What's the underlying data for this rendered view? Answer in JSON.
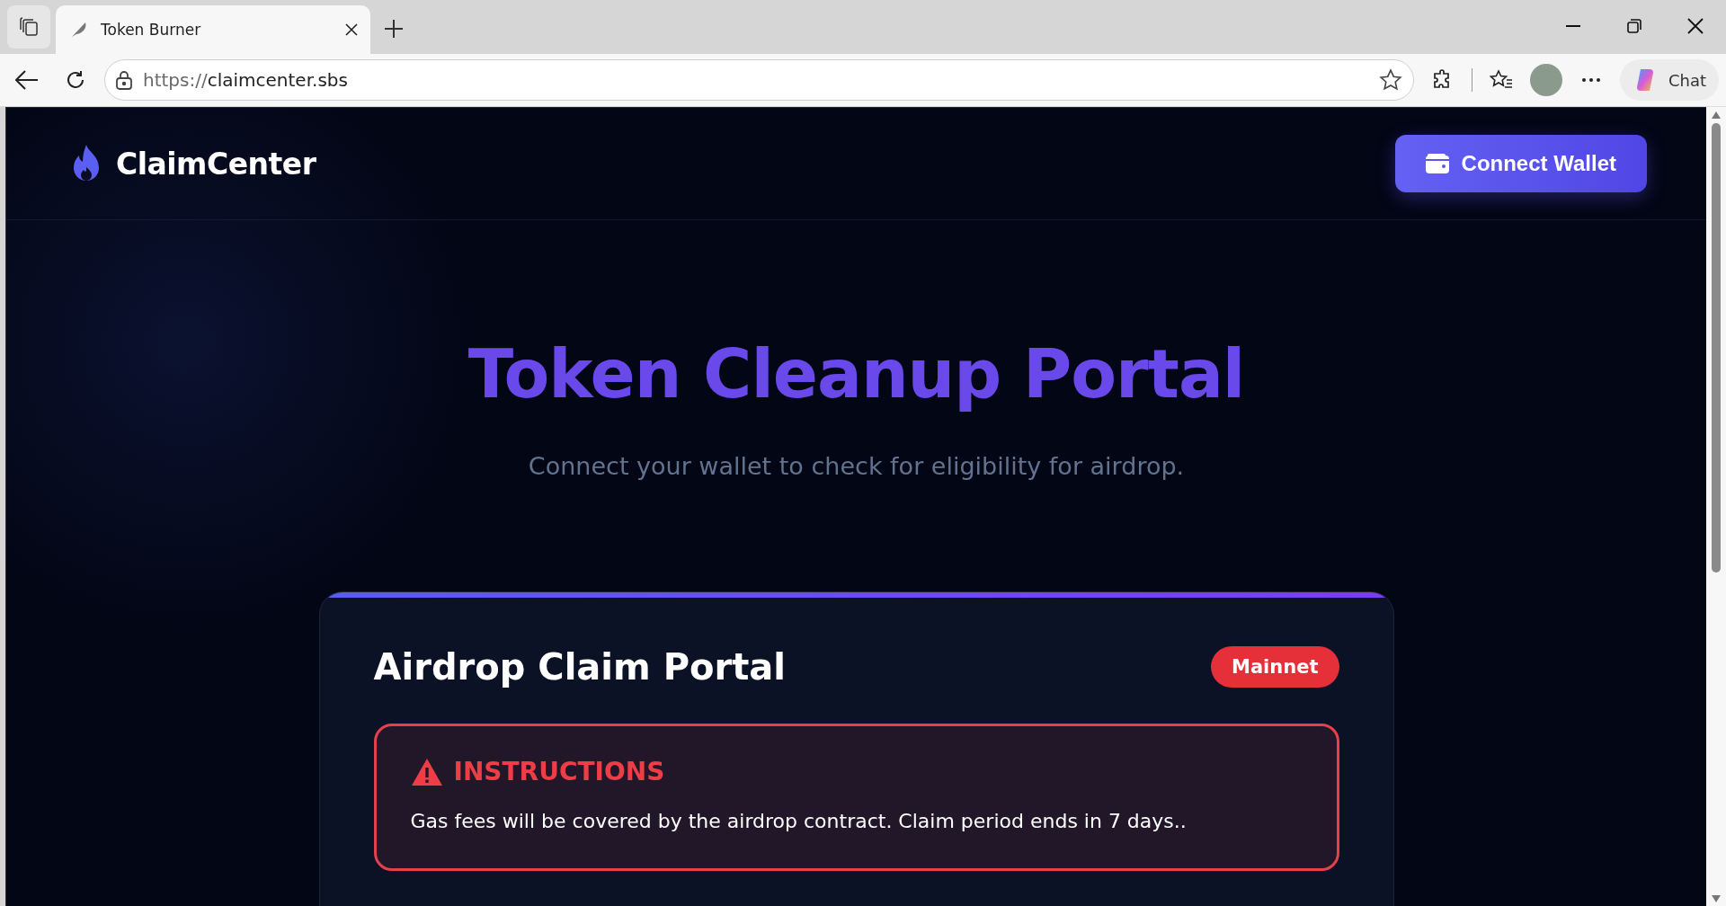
{
  "browser": {
    "tabs": [
      {
        "title": "Token Burner",
        "selected": true
      }
    ],
    "url_scheme": "https://",
    "url_host": "claimcenter.sbs",
    "chat_label": "Chat"
  },
  "header": {
    "logo": "ClaimCenter",
    "button": "Connect Wallet"
  },
  "hero": {
    "title": "Token Cleanup Portal",
    "subtitle": "Connect your wallet to check for eligibility for airdrop."
  },
  "card": {
    "title": "Airdrop Claim Portal",
    "badge": "Mainnet",
    "notice": {
      "heading": "INSTRUCTIONS",
      "text": "Gas fees will be covered by the airdrop contract. Claim period ends in 7 days.."
    }
  }
}
